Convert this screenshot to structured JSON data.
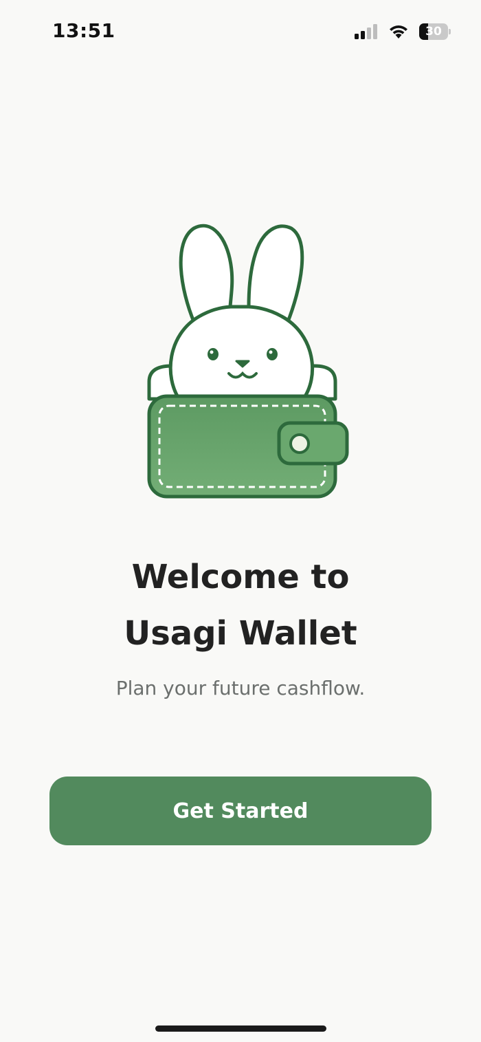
{
  "status_bar": {
    "time": "13:51",
    "battery_level": "30",
    "battery_percent": 30,
    "signal_icon": "cellular-signal-icon",
    "wifi_icon": "wifi-icon",
    "battery_icon": "battery-icon"
  },
  "illustration": {
    "icon": "bunny-in-wallet-icon",
    "colors": {
      "outline": "#2d6a3c",
      "wallet_fill": "#6aa86e",
      "bunny_fill": "#ffffff",
      "stitch": "#ffffff"
    }
  },
  "welcome": {
    "title_line1": "Welcome to",
    "title_line2": "Usagi Wallet",
    "subtitle": "Plan your future cashflow."
  },
  "actions": {
    "get_started_label": "Get Started"
  },
  "colors": {
    "background": "#f9f9f7",
    "accent": "#528a5d",
    "title": "#222222",
    "subtitle": "#6b6f6d"
  }
}
